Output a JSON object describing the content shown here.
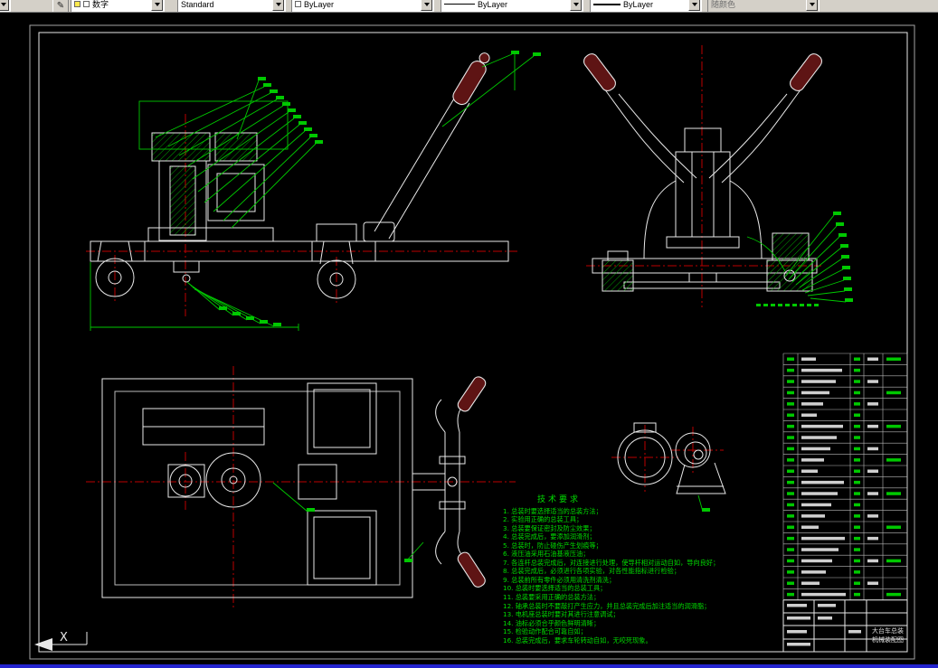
{
  "toolbar": {
    "layer_tool_icon": "✎",
    "layer_value": "数字",
    "text_style_value": "Standard",
    "color_value": "ByLayer",
    "linetype_value": "ByLayer",
    "lineweight_value": "ByLayer",
    "plot_style_value": "随颜色"
  },
  "drawing": {
    "ucs_label": "X",
    "tech_requirements": {
      "title": "技术要求",
      "items": [
        "1. 总装时要选择适当的总装方法；",
        "2. 实验用正确的总装工具；",
        "3. 总装要保证密封及防尘效果；",
        "4. 总装完成后，要添加润滑剂；",
        "5. 总装时，防止碰伤产生划痕等；",
        "6. 液压油采用石油基液压油；",
        "7. 各连杆总装完成后，对连接进行处理，使导杆相对运动自如，导向良好；",
        "8. 总装完成后，必须进行各项实验，对各性能指标进行检验；",
        "9. 总装前所有零件必须用清洗剂清洗；",
        "10. 总装时要选择适当的总装工具；",
        "11. 总装要采用正确的总装方法；",
        "12. 轴承总装时不要敲打产生应力，并且总装完成后加注适当的润滑脂；",
        "13. 电机座总装时要对其进行注意调试；",
        "14. 油标必须合乎颜色鲜明清晰；",
        "15. 检验动作配合可靠自如；",
        "16. 总装完成后，要求车轮转动自如，无咬死现象。"
      ]
    },
    "title_block": {
      "line1": "大台车总装",
      "line2": "机械装配图"
    }
  },
  "colors": {
    "canvas_bg": "#000000",
    "toolbar_bg": "#d4d0c8",
    "drawing_line": "#e8e8e8",
    "dimension_green": "#00c800",
    "centerline_red": "#bb0000",
    "grip_maroon": "#5e1414",
    "bottom_strip_blue": "#2323cf"
  }
}
